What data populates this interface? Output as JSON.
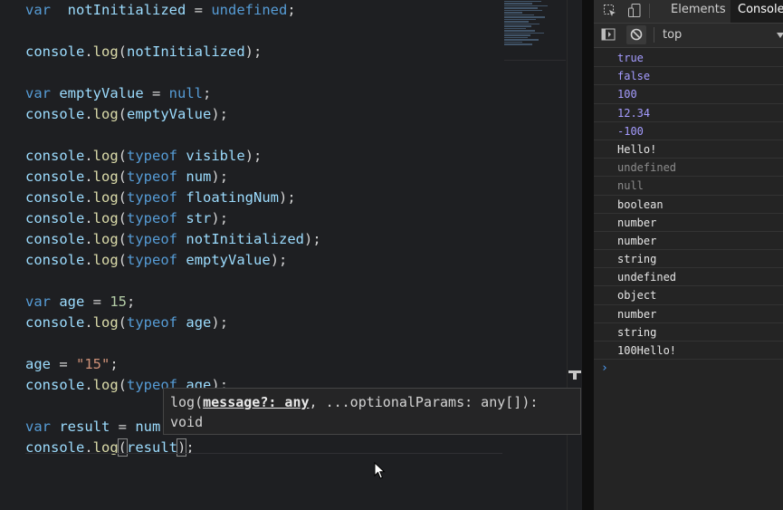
{
  "editor": {
    "lines": [
      [
        [
          "kw",
          "var"
        ],
        [
          "",
          "  "
        ],
        [
          "id",
          "notInitialized"
        ],
        [
          "",
          " = "
        ],
        [
          "kw",
          "undefined"
        ],
        [
          "",
          ";"
        ]
      ],
      [],
      [
        [
          "id",
          "console"
        ],
        [
          "",
          "."
        ],
        [
          "fn",
          "log"
        ],
        [
          "",
          "("
        ],
        [
          "id",
          "notInitialized"
        ],
        [
          "",
          ");"
        ]
      ],
      [],
      [
        [
          "kw",
          "var"
        ],
        [
          "",
          " "
        ],
        [
          "id",
          "emptyValue"
        ],
        [
          "",
          " = "
        ],
        [
          "kw",
          "null"
        ],
        [
          "",
          ";"
        ]
      ],
      [
        [
          "id",
          "console"
        ],
        [
          "",
          "."
        ],
        [
          "fn",
          "log"
        ],
        [
          "",
          "("
        ],
        [
          "id",
          "emptyValue"
        ],
        [
          "",
          ");"
        ]
      ],
      [],
      [
        [
          "id",
          "console"
        ],
        [
          "",
          "."
        ],
        [
          "fn",
          "log"
        ],
        [
          "",
          "("
        ],
        [
          "kw",
          "typeof"
        ],
        [
          "",
          " "
        ],
        [
          "id",
          "visible"
        ],
        [
          "",
          ");"
        ]
      ],
      [
        [
          "id",
          "console"
        ],
        [
          "",
          "."
        ],
        [
          "fn",
          "log"
        ],
        [
          "",
          "("
        ],
        [
          "kw",
          "typeof"
        ],
        [
          "",
          " "
        ],
        [
          "id",
          "num"
        ],
        [
          "",
          ");"
        ]
      ],
      [
        [
          "id",
          "console"
        ],
        [
          "",
          "."
        ],
        [
          "fn",
          "log"
        ],
        [
          "",
          "("
        ],
        [
          "kw",
          "typeof"
        ],
        [
          "",
          " "
        ],
        [
          "id",
          "floatingNum"
        ],
        [
          "",
          ");"
        ]
      ],
      [
        [
          "id",
          "console"
        ],
        [
          "",
          "."
        ],
        [
          "fn",
          "log"
        ],
        [
          "",
          "("
        ],
        [
          "kw",
          "typeof"
        ],
        [
          "",
          " "
        ],
        [
          "id",
          "str"
        ],
        [
          "",
          ");"
        ]
      ],
      [
        [
          "id",
          "console"
        ],
        [
          "",
          "."
        ],
        [
          "fn",
          "log"
        ],
        [
          "",
          "("
        ],
        [
          "kw",
          "typeof"
        ],
        [
          "",
          " "
        ],
        [
          "id",
          "notInitialized"
        ],
        [
          "",
          ");"
        ]
      ],
      [
        [
          "id",
          "console"
        ],
        [
          "",
          "."
        ],
        [
          "fn",
          "log"
        ],
        [
          "",
          "("
        ],
        [
          "kw",
          "typeof"
        ],
        [
          "",
          " "
        ],
        [
          "id",
          "emptyValue"
        ],
        [
          "",
          ");"
        ]
      ],
      [],
      [
        [
          "kw",
          "var"
        ],
        [
          "",
          " "
        ],
        [
          "id",
          "age"
        ],
        [
          "",
          " = "
        ],
        [
          "num",
          "15"
        ],
        [
          "",
          ";"
        ]
      ],
      [
        [
          "id",
          "console"
        ],
        [
          "",
          "."
        ],
        [
          "fn",
          "log"
        ],
        [
          "",
          "("
        ],
        [
          "kw",
          "typeof"
        ],
        [
          "",
          " "
        ],
        [
          "id",
          "age"
        ],
        [
          "",
          ");"
        ]
      ],
      [],
      [
        [
          "id",
          "age"
        ],
        [
          "",
          " = "
        ],
        [
          "str",
          "\"15\""
        ],
        [
          "",
          ";"
        ]
      ],
      [
        [
          "id",
          "console"
        ],
        [
          "",
          "."
        ],
        [
          "fn",
          "log"
        ],
        [
          "",
          "("
        ],
        [
          "kw",
          "typeof"
        ],
        [
          "",
          " "
        ],
        [
          "id",
          "age"
        ],
        [
          "",
          ");"
        ]
      ],
      [],
      [
        [
          "kw",
          "var"
        ],
        [
          "",
          " "
        ],
        [
          "id",
          "result"
        ],
        [
          "",
          " = "
        ],
        [
          "id",
          "num"
        ]
      ],
      [
        [
          "id",
          "console"
        ],
        [
          "",
          "."
        ],
        [
          "fn",
          "log"
        ],
        [
          "box",
          "("
        ],
        [
          "id",
          "result"
        ],
        [
          "box",
          ")"
        ],
        [
          "",
          ";"
        ]
      ]
    ],
    "hover": {
      "pre": "log(",
      "param": "message?: any",
      "post": ", ...optionalParams: any[]):",
      "ret": "void"
    }
  },
  "devtools": {
    "tabs": [
      "Elements",
      "Console"
    ],
    "active_tab": "Console",
    "context": "top",
    "icons": [
      "inspect-icon",
      "device-toolbar-icon",
      "sidebar-toggle-icon",
      "clear-console-icon",
      "dropdown-icon"
    ],
    "console_rows": [
      {
        "text": "true",
        "kind": "bool"
      },
      {
        "text": "false",
        "kind": "bool"
      },
      {
        "text": "100",
        "kind": "numv"
      },
      {
        "text": "12.34",
        "kind": "numv"
      },
      {
        "text": "-100",
        "kind": "numv"
      },
      {
        "text": "Hello!",
        "kind": "str"
      },
      {
        "text": "undefined",
        "kind": "dim"
      },
      {
        "text": "null",
        "kind": "dim"
      },
      {
        "text": "boolean",
        "kind": "str"
      },
      {
        "text": "number",
        "kind": "str"
      },
      {
        "text": "number",
        "kind": "str"
      },
      {
        "text": "string",
        "kind": "str"
      },
      {
        "text": "undefined",
        "kind": "str"
      },
      {
        "text": "object",
        "kind": "str"
      },
      {
        "text": "number",
        "kind": "str"
      },
      {
        "text": "string",
        "kind": "str"
      },
      {
        "text": "100Hello!",
        "kind": "str"
      }
    ],
    "prompt": "›"
  },
  "colors": {
    "keyword": "#569cd6",
    "function": "#dcdcaa",
    "identifier": "#9cdcfe",
    "number": "#b5cea8",
    "string": "#ce9178",
    "console_value": "#a59cff",
    "console_dim": "#8c8c8c",
    "prompt": "#4e9ef8"
  }
}
